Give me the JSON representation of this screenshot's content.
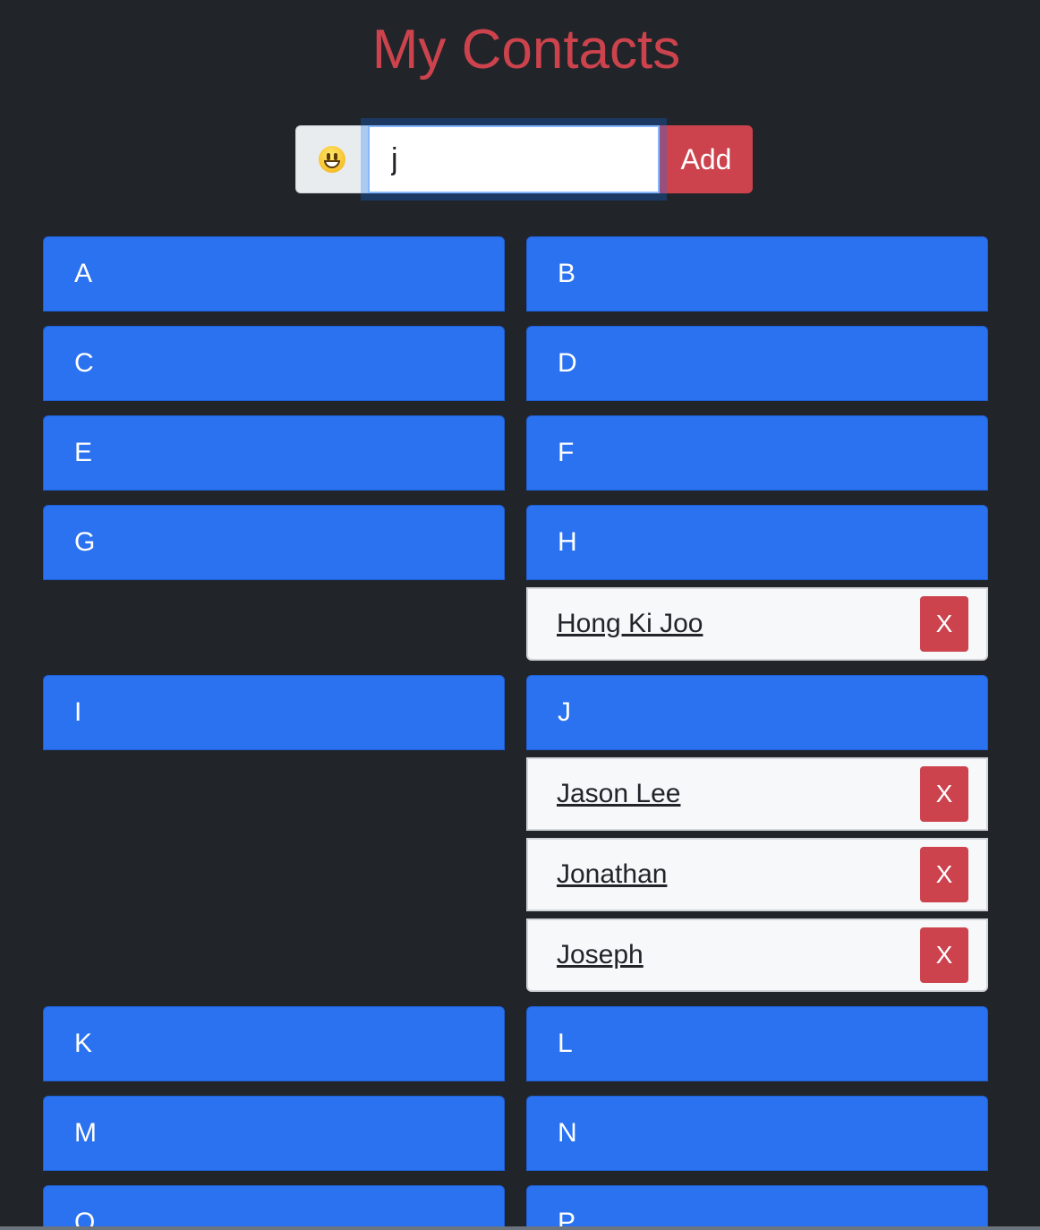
{
  "title": "My Contacts",
  "form": {
    "emoji_icon": "grinning-face-emoji",
    "input_value": "j",
    "add_label": "Add"
  },
  "colors": {
    "background": "#212529",
    "title": "#cc434d",
    "header": "#2b72f0",
    "danger": "#cc434d",
    "item_bg": "#f7f8fa"
  },
  "groups": {
    "A": {
      "letter": "A",
      "contacts": []
    },
    "B": {
      "letter": "B",
      "contacts": []
    },
    "C": {
      "letter": "C",
      "contacts": []
    },
    "D": {
      "letter": "D",
      "contacts": []
    },
    "E": {
      "letter": "E",
      "contacts": []
    },
    "F": {
      "letter": "F",
      "contacts": []
    },
    "G": {
      "letter": "G",
      "contacts": []
    },
    "H": {
      "letter": "H",
      "contacts": [
        {
          "name": "Hong Ki Joo",
          "delete_label": "X"
        }
      ]
    },
    "I": {
      "letter": "I",
      "contacts": []
    },
    "J": {
      "letter": "J",
      "contacts": [
        {
          "name": "Jason Lee",
          "delete_label": "X"
        },
        {
          "name": "Jonathan",
          "delete_label": "X"
        },
        {
          "name": "Joseph",
          "delete_label": "X"
        }
      ]
    },
    "K": {
      "letter": "K",
      "contacts": []
    },
    "L": {
      "letter": "L",
      "contacts": []
    },
    "M": {
      "letter": "M",
      "contacts": []
    },
    "N": {
      "letter": "N",
      "contacts": []
    },
    "O": {
      "letter": "O",
      "contacts": []
    },
    "P": {
      "letter": "P",
      "contacts": []
    }
  }
}
